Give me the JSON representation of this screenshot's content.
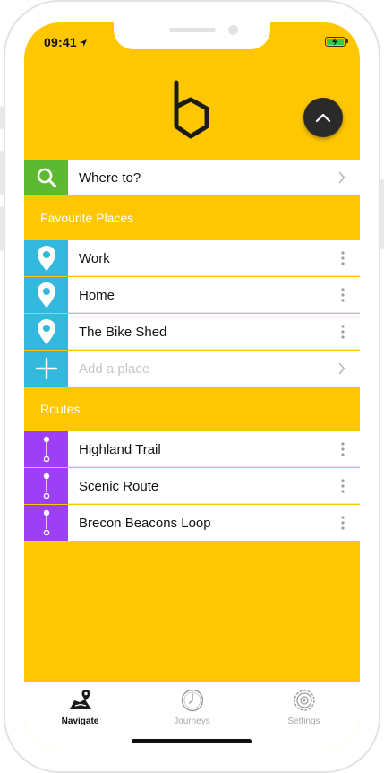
{
  "status_bar": {
    "time": "09:41"
  },
  "search": {
    "label": "Where to?"
  },
  "favourites": {
    "title": "Favourite Places",
    "items": [
      {
        "label": "Work"
      },
      {
        "label": "Home"
      },
      {
        "label": "The Bike Shed"
      }
    ],
    "add_placeholder": "Add a place"
  },
  "routes": {
    "title": "Routes",
    "items": [
      {
        "label": "Highland Trail"
      },
      {
        "label": "Scenic Route"
      },
      {
        "label": "Brecon Beacons Loop"
      }
    ]
  },
  "tabs": [
    {
      "label": "Navigate",
      "icon": "map-icon",
      "active": true
    },
    {
      "label": "Journeys",
      "icon": "clock-icon",
      "active": false
    },
    {
      "label": "Settings",
      "icon": "gear-icon",
      "active": false
    }
  ],
  "colors": {
    "background": "#fec701",
    "search_tile": "#5cb931",
    "place_tile": "#34b8de",
    "route_tile": "#9d3ff5"
  }
}
